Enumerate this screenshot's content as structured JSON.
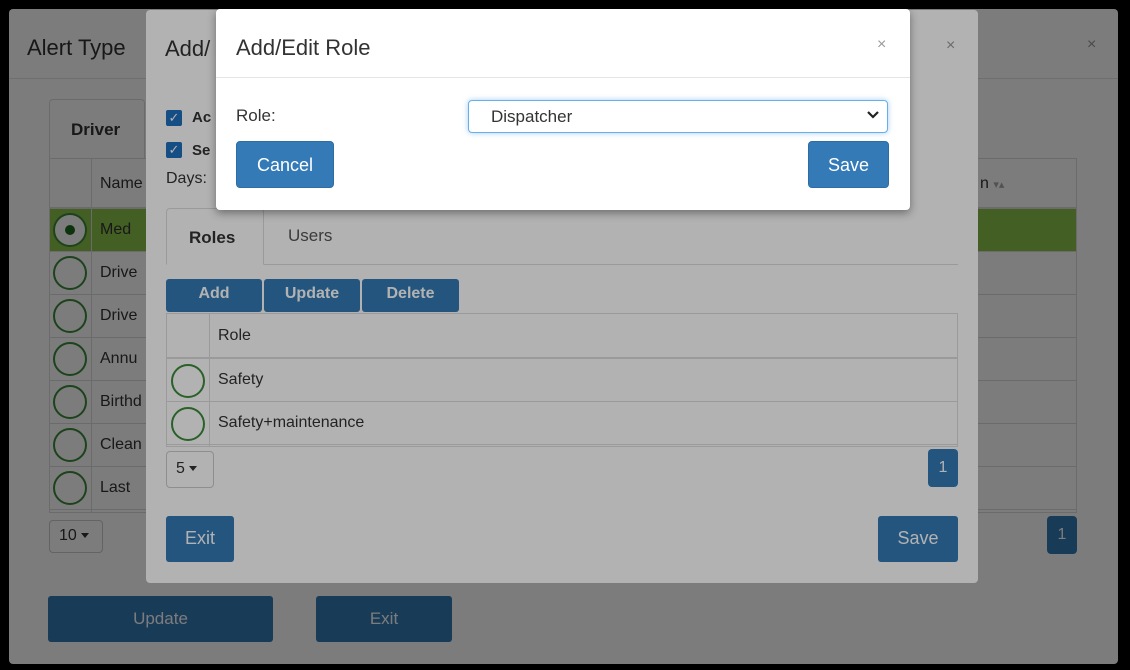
{
  "alert_type_window": {
    "title": "Alert Type",
    "close": "×",
    "tab": "Driver",
    "columns": [
      "Name",
      "n"
    ],
    "rows": [
      {
        "label": "Med",
        "selected": true
      },
      {
        "label": "Drive",
        "selected": false
      },
      {
        "label": "Drive",
        "selected": false
      },
      {
        "label": "Annu",
        "selected": false
      },
      {
        "label": "Birthd",
        "selected": false
      },
      {
        "label": "Clean",
        "selected": false
      },
      {
        "label": "Last",
        "selected": false
      }
    ],
    "page_size": "10",
    "page": "1",
    "update_label": "Update",
    "exit_label": "Exit"
  },
  "add_edit_window": {
    "title": "Add/",
    "close": "×",
    "check1_label": "Ac",
    "check2_label": "Se",
    "days_label": "Days:",
    "tab_roles": "Roles",
    "tab_users": "Users",
    "add_label": "Add",
    "update_label": "Update",
    "delete_label": "Delete",
    "grid_header": "Role",
    "roles": [
      "Safety",
      "Safety+maintenance"
    ],
    "page_size": "5",
    "page": "1",
    "exit_label": "Exit",
    "save_label": "Save"
  },
  "role_dialog": {
    "title": "Add/Edit Role",
    "close": "×",
    "role_label": "Role:",
    "role_value": "Dispatcher",
    "cancel_label": "Cancel",
    "save_label": "Save"
  },
  "colors": {
    "primary": "#337ab7",
    "selected_row": "#8bc34a",
    "radio_border": "#3c8c3c"
  }
}
